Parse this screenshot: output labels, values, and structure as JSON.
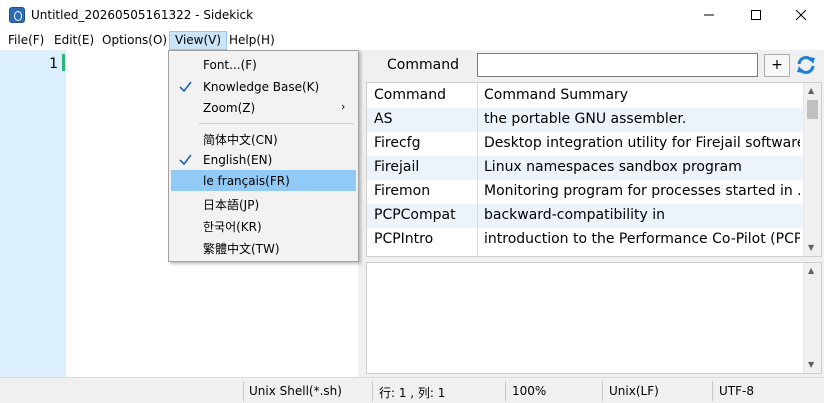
{
  "window": {
    "title": "Untitled_20260505161322  -  Sidekick"
  },
  "menubar": {
    "items": [
      "File(F)",
      "Edit(E)",
      "Options(O)",
      "View(V)",
      "Help(H)"
    ],
    "active": "View(V)"
  },
  "editor": {
    "line_number": "1"
  },
  "view_menu": {
    "items": [
      {
        "label": "Font...(F)",
        "checked": false,
        "submenu": false
      },
      {
        "label": "Knowledge Base(K)",
        "checked": true,
        "submenu": false
      },
      {
        "label": "Zoom(Z)",
        "checked": false,
        "submenu": true
      },
      {
        "label": "简体中文(CN)",
        "checked": false,
        "submenu": false
      },
      {
        "label": "English(EN)",
        "checked": true,
        "submenu": false
      },
      {
        "label": "le français(FR)",
        "checked": false,
        "submenu": false,
        "highlighted": true
      },
      {
        "label": "日本語(JP)",
        "checked": false,
        "submenu": false
      },
      {
        "label": "한국어(KR)",
        "checked": false,
        "submenu": false
      },
      {
        "label": "繁體中文(TW)",
        "checked": false,
        "submenu": false
      }
    ],
    "submenu_arrow": "›"
  },
  "command_panel": {
    "label": "Command",
    "input_value": "",
    "add_button": "+",
    "refresh_icon": "refresh-icon"
  },
  "command_table": {
    "columns": [
      "Command",
      "Command Summary"
    ],
    "rows": [
      [
        "AS",
        "the portable GNU assembler."
      ],
      [
        "Firecfg",
        "Desktop integration utility for Firejail software."
      ],
      [
        "Firejail",
        "Linux namespaces sandbox program"
      ],
      [
        "Firemon",
        "Monitoring program for processes started in ..."
      ],
      [
        "PCPCompat",
        "backward-compatibility in"
      ],
      [
        "PCPIntro",
        "introduction to the Performance Co-Pilot (PCP)"
      ]
    ]
  },
  "statusbar": {
    "language": "Unix Shell(*.sh)",
    "position": "行: 1 ,  列: 1",
    "zoom": "100%",
    "eol": "Unix(LF)",
    "encoding": "UTF-8"
  },
  "colors": {
    "gutter": "#dbf0fc",
    "highlight": "#91c9f7",
    "accent": "#1e7fd8"
  }
}
